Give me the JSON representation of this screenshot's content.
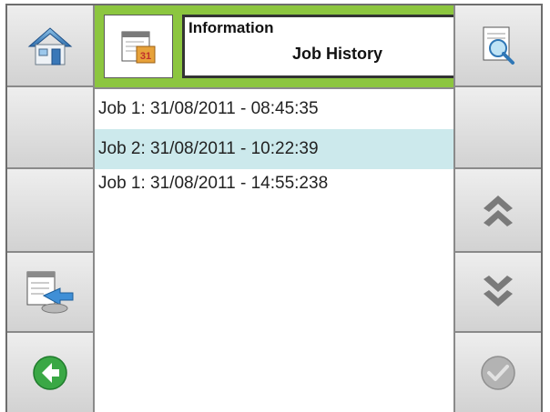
{
  "header": {
    "title_small": "Information",
    "title_large": "Job History"
  },
  "jobs": [
    {
      "label": "Job 1: 31/08/2011 - 08:45:35",
      "selected": false
    },
    {
      "label": "Job 2: 31/08/2011 - 10:22:39",
      "selected": true
    },
    {
      "label": "Job 1: 31/08/2011 - 14:55:238",
      "selected": false
    }
  ],
  "left_buttons": [
    "home-icon",
    "",
    "",
    "export-icon",
    "back-arrow-icon"
  ],
  "right_buttons": [
    "document-search-icon",
    "",
    "scroll-up-icon",
    "scroll-down-icon",
    "confirm-check-icon"
  ],
  "colors": {
    "header_green": "#8cc63f",
    "selected_row": "#cce9ec",
    "back_green": "#3aa845"
  }
}
